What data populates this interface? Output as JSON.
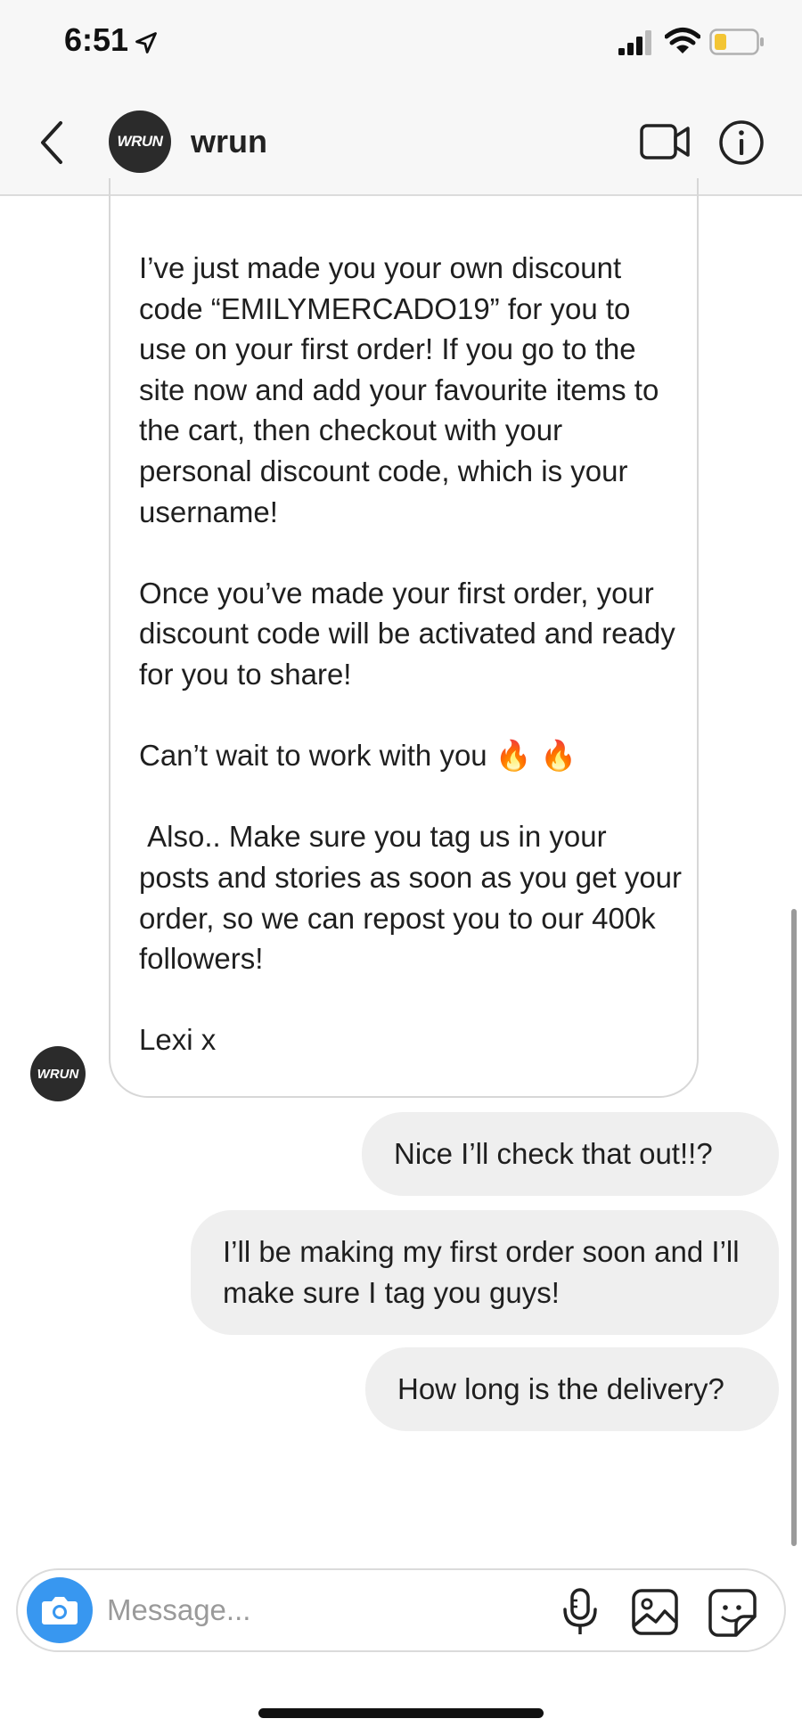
{
  "status_bar": {
    "time": "6:51"
  },
  "header": {
    "avatar_text": "WRUN",
    "username": "wrun"
  },
  "conversation": {
    "received": {
      "text": "I’ve just made you your own discount code “EMILYMERCADO19” for you to use on your first order! If you go to the site now and add your favourite items to the cart, then checkout with your personal discount code, which is your username!\n\nOnce you’ve made your first order, your discount code will be activated and ready for you to share!\n\nCan’t wait to work with you 🔥 🔥\n\n Also.. Make sure you tag us in your posts and stories as soon as you get your order, so we can repost you to our 400k followers!\n\nLexi x",
      "avatar_text": "WRUN"
    },
    "sent": [
      {
        "text": "Nice I’ll check that out!!?"
      },
      {
        "text": "I’ll be making my first order soon and I’ll make sure I tag you guys!"
      },
      {
        "text": "How long is the delivery?"
      }
    ]
  },
  "composer": {
    "placeholder": "Message..."
  },
  "colors": {
    "camera_button": "#3897f0",
    "sent_bubble": "#efefef",
    "header_bg": "#f7f7f7"
  },
  "icons": [
    "location-arrow-icon",
    "signal-icon",
    "wifi-icon",
    "battery-icon",
    "back-chevron-icon",
    "video-camera-icon",
    "info-icon",
    "camera-icon",
    "microphone-icon",
    "gallery-icon",
    "sticker-icon"
  ]
}
